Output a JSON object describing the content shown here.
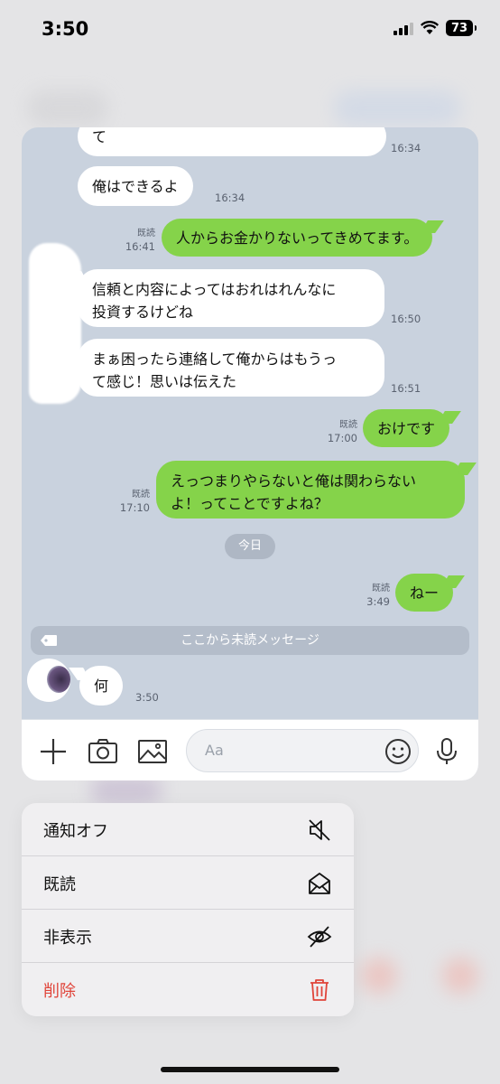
{
  "status": {
    "time": "3:50",
    "battery": "73"
  },
  "chat": {
    "messages": [
      {
        "side": "in",
        "text": "て",
        "time": "16:34"
      },
      {
        "side": "in",
        "text": "俺はできるよ",
        "time": "16:34"
      },
      {
        "side": "out",
        "text": "人からお金かりないってきめてます。",
        "read": "既読",
        "time": "16:41"
      },
      {
        "side": "in",
        "lines": [
          "信頼と内容によってはおれはれんなに",
          "投資するけどね"
        ],
        "time": "16:50"
      },
      {
        "side": "in",
        "lines": [
          "まぁ困ったら連絡して俺からはもうっ",
          "て感じ！思いは伝えた"
        ],
        "time": "16:51"
      },
      {
        "side": "out",
        "text": "おけです",
        "read": "既読",
        "time": "17:00"
      },
      {
        "side": "out",
        "lines": [
          "えっつまりやらないと俺は関わらない",
          "よ！ってことですよね？"
        ],
        "read": "既読",
        "time": "17:10"
      },
      {
        "side": "out",
        "text": "ねー",
        "read": "既読",
        "time": "3:49"
      },
      {
        "side": "in",
        "text": "何",
        "time": "3:50"
      }
    ],
    "date_divider": "今日",
    "unread_divider": "ここから未読メッセージ"
  },
  "input": {
    "placeholder": "Aa"
  },
  "menu": {
    "items": [
      {
        "label": "通知オフ",
        "icon": "speaker-mute-icon"
      },
      {
        "label": "既読",
        "icon": "envelope-open-icon"
      },
      {
        "label": "非表示",
        "icon": "eye-slash-icon"
      },
      {
        "label": "削除",
        "icon": "trash-icon",
        "color": "#e0443a"
      }
    ]
  }
}
